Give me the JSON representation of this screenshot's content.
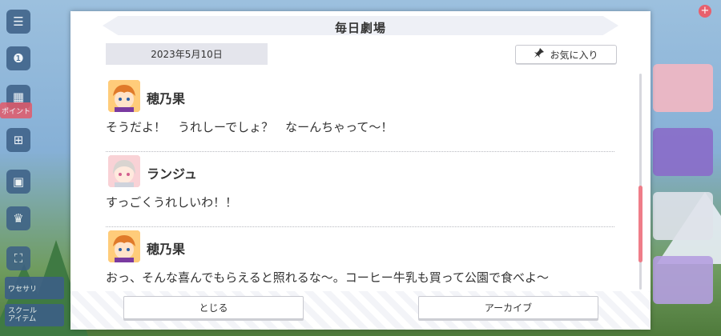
{
  "modal": {
    "title": "毎日劇場",
    "date": "2023年5月10日",
    "favorite_label": "お気に入り",
    "close_label": "とじる",
    "archive_label": "アーカイブ"
  },
  "messages": [
    {
      "speaker": "穂乃果",
      "text": "そうだよ！　うれしーでしょ？　なーんちゃって〜！"
    },
    {
      "speaker": "ランジュ",
      "text": "すっごくうれしいわ！！"
    },
    {
      "speaker": "穂乃果",
      "text": "おっ、そんな喜んでもらえると照れるな〜。コーヒー牛乳も買って公園で食べよ〜"
    }
  ],
  "sidebar_partial_labels": {
    "event": "ポイント",
    "accessory": "ワセサリ",
    "school_item": "スクール\nアイテム"
  },
  "icons": {
    "favorite": "pin-icon",
    "menu": "hamburger-icon"
  },
  "colors": {
    "accent": "#ef7d89",
    "panel": "#ffffff",
    "date_bg": "#e4e5ec"
  }
}
